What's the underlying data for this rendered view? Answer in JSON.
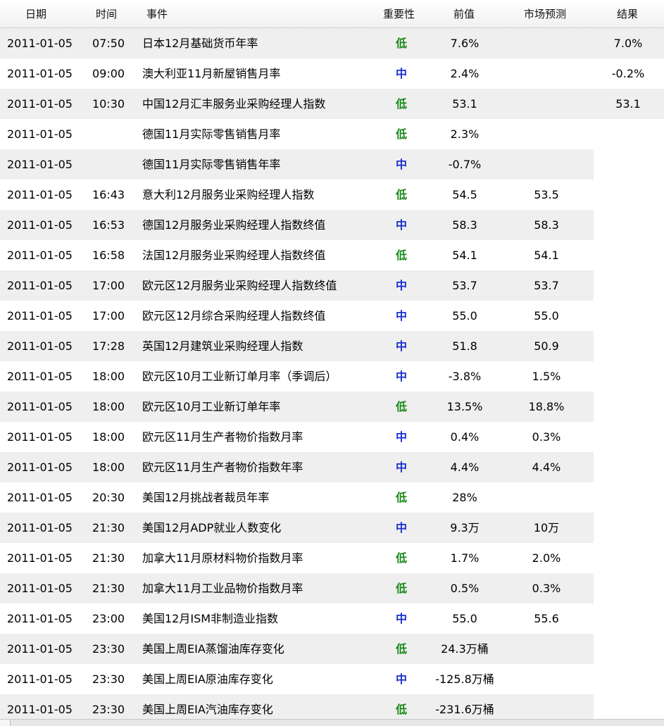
{
  "header": {
    "date": "日期",
    "time": "时间",
    "event": "事件",
    "importance": "重要性",
    "previous": "前值",
    "forecast": "市场预测",
    "result": "结果"
  },
  "rows": [
    {
      "date": "2011-01-05",
      "time": "07:50",
      "event": "日本12月基础货币年率",
      "importance": "低",
      "level": "low",
      "previous": "7.6%",
      "forecast": "",
      "result": "7.0%"
    },
    {
      "date": "2011-01-05",
      "time": "09:00",
      "event": "澳大利亚11月新屋销售月率",
      "importance": "中",
      "level": "mid",
      "previous": "2.4%",
      "forecast": "",
      "result": "-0.2%"
    },
    {
      "date": "2011-01-05",
      "time": "10:30",
      "event": "中国12月汇丰服务业采购经理人指数",
      "importance": "低",
      "level": "low",
      "previous": "53.1",
      "forecast": "",
      "result": "53.1"
    },
    {
      "date": "2011-01-05",
      "time": "",
      "event": "德国11月实际零售销售月率",
      "importance": "低",
      "level": "low",
      "previous": "2.3%",
      "forecast": "",
      "result": ""
    },
    {
      "date": "2011-01-05",
      "time": "",
      "event": "德国11月实际零售销售年率",
      "importance": "中",
      "level": "mid",
      "previous": "-0.7%",
      "forecast": "",
      "result": ""
    },
    {
      "date": "2011-01-05",
      "time": "16:43",
      "event": "意大利12月服务业采购经理人指数",
      "importance": "低",
      "level": "low",
      "previous": "54.5",
      "forecast": "53.5",
      "result": ""
    },
    {
      "date": "2011-01-05",
      "time": "16:53",
      "event": "德国12月服务业采购经理人指数终值",
      "importance": "中",
      "level": "mid",
      "previous": "58.3",
      "forecast": "58.3",
      "result": ""
    },
    {
      "date": "2011-01-05",
      "time": "16:58",
      "event": "法国12月服务业采购经理人指数终值",
      "importance": "低",
      "level": "low",
      "previous": "54.1",
      "forecast": "54.1",
      "result": ""
    },
    {
      "date": "2011-01-05",
      "time": "17:00",
      "event": "欧元区12月服务业采购经理人指数终值",
      "importance": "中",
      "level": "mid",
      "previous": "53.7",
      "forecast": "53.7",
      "result": ""
    },
    {
      "date": "2011-01-05",
      "time": "17:00",
      "event": "欧元区12月综合采购经理人指数终值",
      "importance": "中",
      "level": "mid",
      "previous": "55.0",
      "forecast": "55.0",
      "result": ""
    },
    {
      "date": "2011-01-05",
      "time": "17:28",
      "event": "英国12月建筑业采购经理人指数",
      "importance": "中",
      "level": "mid",
      "previous": "51.8",
      "forecast": "50.9",
      "result": ""
    },
    {
      "date": "2011-01-05",
      "time": "18:00",
      "event": "欧元区10月工业新订单月率（季调后）",
      "importance": "中",
      "level": "mid",
      "previous": "-3.8%",
      "forecast": "1.5%",
      "result": ""
    },
    {
      "date": "2011-01-05",
      "time": "18:00",
      "event": "欧元区10月工业新订单年率",
      "importance": "低",
      "level": "low",
      "previous": "13.5%",
      "forecast": "18.8%",
      "result": ""
    },
    {
      "date": "2011-01-05",
      "time": "18:00",
      "event": "欧元区11月生产者物价指数月率",
      "importance": "中",
      "level": "mid",
      "previous": "0.4%",
      "forecast": "0.3%",
      "result": ""
    },
    {
      "date": "2011-01-05",
      "time": "18:00",
      "event": "欧元区11月生产者物价指数年率",
      "importance": "中",
      "level": "mid",
      "previous": "4.4%",
      "forecast": "4.4%",
      "result": ""
    },
    {
      "date": "2011-01-05",
      "time": "20:30",
      "event": "美国12月挑战者裁员年率",
      "importance": "低",
      "level": "low",
      "previous": "28%",
      "forecast": "",
      "result": ""
    },
    {
      "date": "2011-01-05",
      "time": "21:30",
      "event": "美国12月ADP就业人数变化",
      "importance": "中",
      "level": "mid",
      "previous": "9.3万",
      "forecast": "10万",
      "result": ""
    },
    {
      "date": "2011-01-05",
      "time": "21:30",
      "event": "加拿大11月原材料物价指数月率",
      "importance": "低",
      "level": "low",
      "previous": "1.7%",
      "forecast": "2.0%",
      "result": ""
    },
    {
      "date": "2011-01-05",
      "time": "21:30",
      "event": "加拿大11月工业品物价指数月率",
      "importance": "低",
      "level": "low",
      "previous": "0.5%",
      "forecast": "0.3%",
      "result": ""
    },
    {
      "date": "2011-01-05",
      "time": "23:00",
      "event": "美国12月ISM非制造业指数",
      "importance": "中",
      "level": "mid",
      "previous": "55.0",
      "forecast": "55.6",
      "result": ""
    },
    {
      "date": "2011-01-05",
      "time": "23:30",
      "event": "美国上周EIA蒸馏油库存变化",
      "importance": "低",
      "level": "low",
      "previous": "24.3万桶",
      "forecast": "",
      "result": ""
    },
    {
      "date": "2011-01-05",
      "time": "23:30",
      "event": "美国上周EIA原油库存变化",
      "importance": "中",
      "level": "mid",
      "previous": "-125.8万桶",
      "forecast": "",
      "result": ""
    },
    {
      "date": "2011-01-05",
      "time": "23:30",
      "event": "美国上周EIA汽油库存变化",
      "importance": "低",
      "level": "low",
      "previous": "-231.6万桶",
      "forecast": "",
      "result": ""
    }
  ]
}
